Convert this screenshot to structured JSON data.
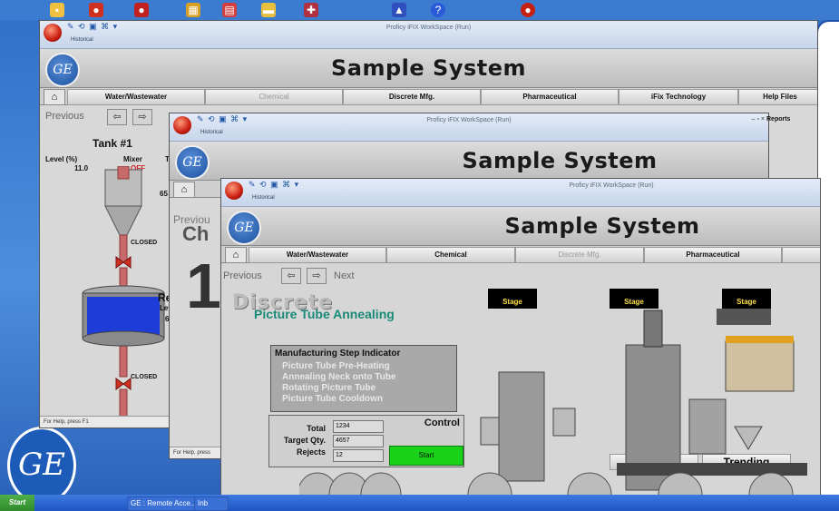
{
  "window1": {
    "title": "Proficy iFIX WorkSpace (Run)",
    "tab": "Historical",
    "system_title": "Sample System",
    "nav": [
      "Water/Wastewater",
      "Chemical",
      "Discrete Mfg.",
      "Pharmaceutical",
      "iFix Technology",
      "Help Files"
    ],
    "prev_label": "Previous",
    "tank_title": "Tank #1",
    "level_label": "Level (%)",
    "level_value": "11.0",
    "mixer_label": "Mixer",
    "mixer_state": "OFF",
    "temp_label": "Ter",
    "temp_value": "65",
    "valve1_state": "CLOSED",
    "valve2_state": "CLOSED",
    "reactor_label": "Re",
    "reactor_level": "Lev",
    "reactor_value": "6",
    "status": "For Help, press F1"
  },
  "window2": {
    "title": "Proficy iFIX WorkSpace (Run)",
    "tab": "Historical",
    "system_title": "Sample System",
    "prev_label": "Previou",
    "big_text": "Ch",
    "big_digit": "1",
    "reports": "Reports",
    "status": "For Help, press"
  },
  "window3": {
    "title": "Proficy iFIX WorkSpace (Run)",
    "tab": "Historical",
    "system_title": "Sample System",
    "nav": [
      "Water/Wastewater",
      "Chemical",
      "Discrete Mfg.",
      "Pharmaceutical"
    ],
    "prev_label": "Previous",
    "next_label": "Next",
    "btn_discrete": "Discrete",
    "btn_trending": "Trending",
    "heading": "Discrete",
    "subheading": "Picture Tube Annealing",
    "stages": [
      "Stage",
      "Stage",
      "Stage"
    ],
    "msi": {
      "title": "Manufacturing Step Indicator",
      "steps": [
        "Picture Tube Pre-Heating",
        "Annealing Neck onto Tube",
        "Rotating Picture Tube",
        "Picture Tube Cooldown"
      ]
    },
    "control": {
      "title": "Control",
      "total_label": "Total",
      "total_value": "1234",
      "target_label": "Target Qty.",
      "target_value": "4657",
      "rejects_label": "Rejects",
      "rejects_value": "12",
      "start_label": "Start"
    }
  },
  "taskbar": {
    "start": "Start",
    "items": [
      "GE : Remote Acce...",
      "Inb"
    ]
  },
  "colors": {
    "desktop": "#3f7fd0",
    "start_green": "#19d219",
    "stage_text": "#ffe04a",
    "pipe": "#c86a6a"
  }
}
